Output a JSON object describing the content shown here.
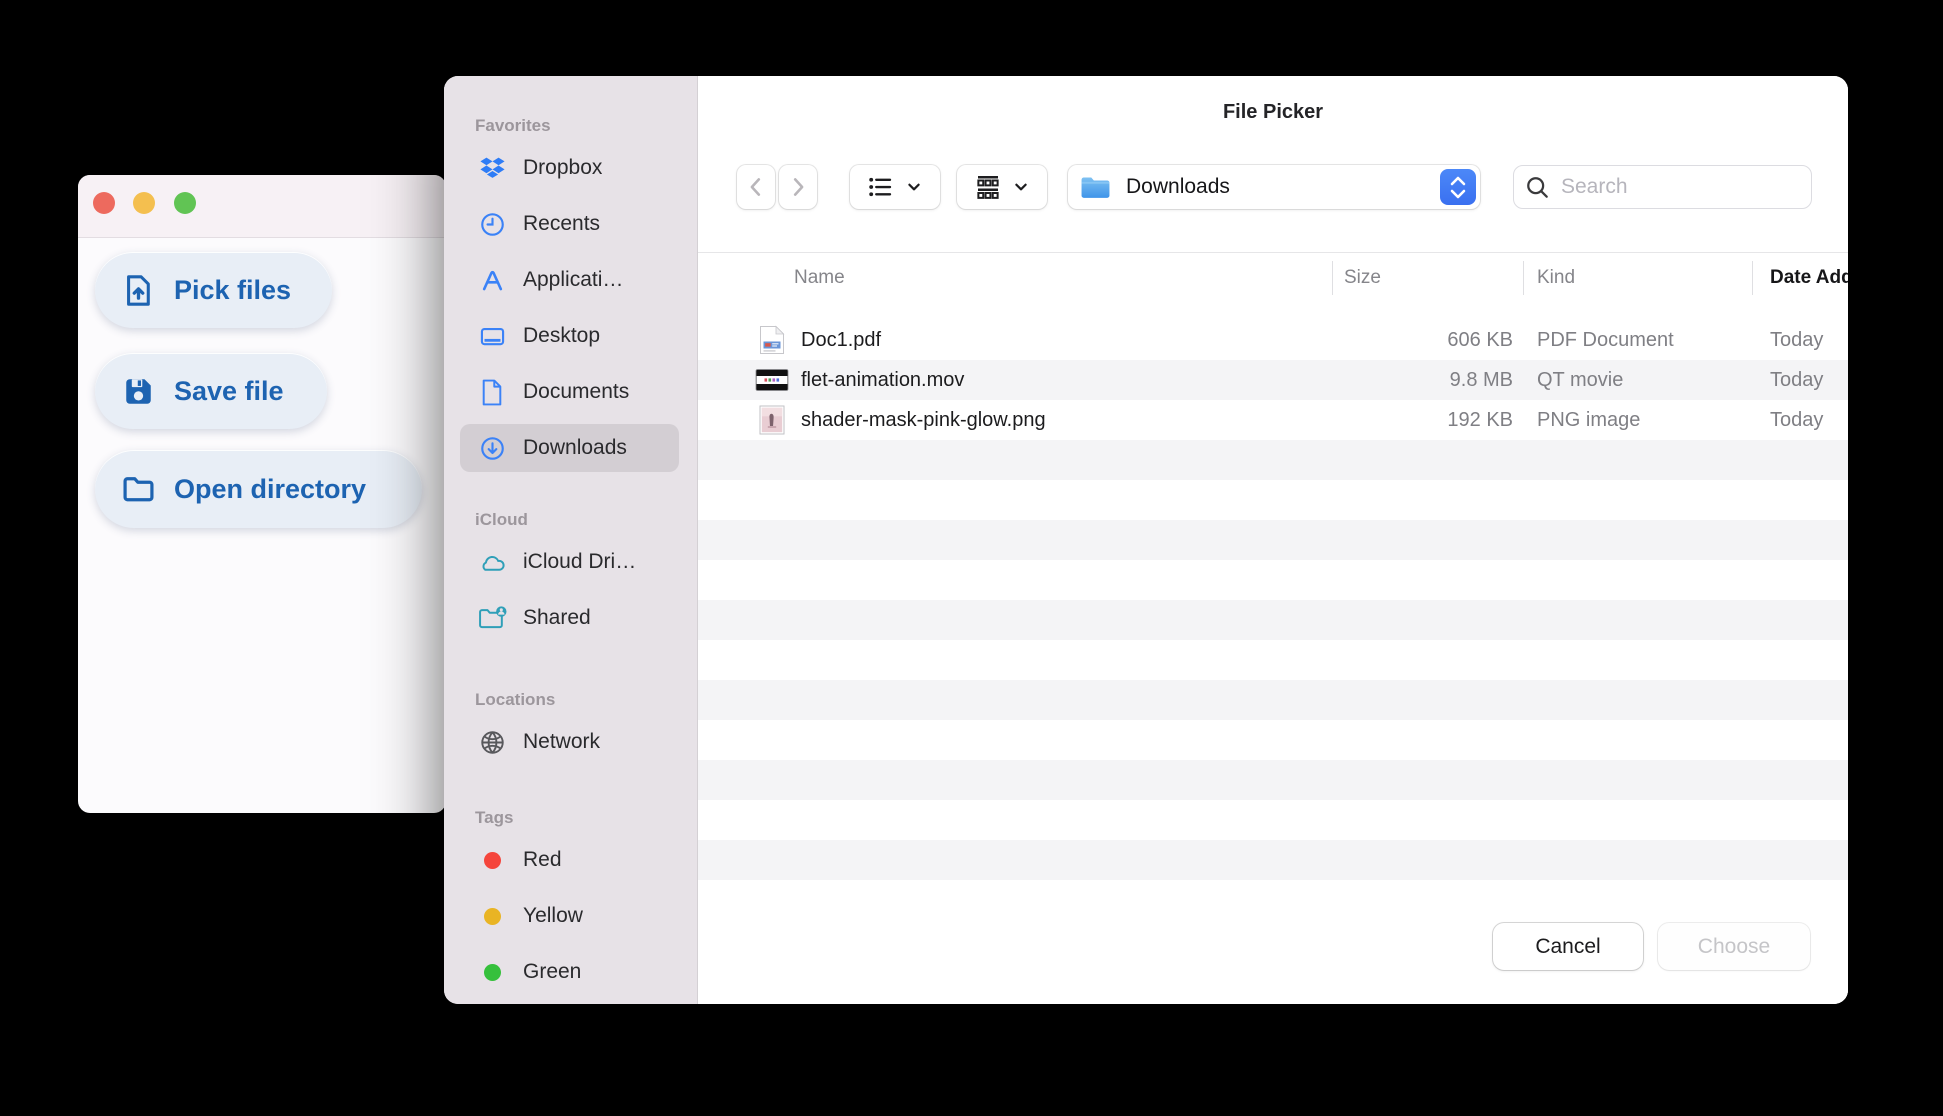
{
  "app_window": {
    "traffic_lights": [
      "close",
      "minimize",
      "zoom"
    ],
    "accent_color": "#1d63b1",
    "buttons": [
      {
        "label": "Pick files",
        "icon": "file-upload"
      },
      {
        "label": "Save file",
        "icon": "save-floppy"
      },
      {
        "label": "Open directory",
        "icon": "folder-open"
      }
    ]
  },
  "dialog": {
    "title": "File Picker",
    "sidebar": {
      "sections": [
        {
          "title": "Favorites",
          "items": [
            {
              "label": "Dropbox",
              "icon": "dropbox",
              "color": "#2e7cf6"
            },
            {
              "label": "Recents",
              "icon": "clock",
              "color": "#3b82f7"
            },
            {
              "label": "Applicati…",
              "icon": "app-store",
              "color": "#3b82f7"
            },
            {
              "label": "Desktop",
              "icon": "desktop",
              "color": "#3b82f7"
            },
            {
              "label": "Documents",
              "icon": "document",
              "color": "#3b82f7"
            },
            {
              "label": "Downloads",
              "icon": "download-circle",
              "color": "#3b82f7",
              "selected": true
            }
          ]
        },
        {
          "title": "iCloud",
          "items": [
            {
              "label": "iCloud Dri…",
              "icon": "cloud",
              "color": "#2f9fb8"
            },
            {
              "label": "Shared",
              "icon": "shared-folder",
              "color": "#2f9fb8"
            }
          ]
        },
        {
          "title": "Locations",
          "items": [
            {
              "label": "Network",
              "icon": "globe",
              "color": "#58585c"
            }
          ]
        },
        {
          "title": "Tags",
          "items": [
            {
              "label": "Red",
              "icon": "tag-dot",
              "color": "#f5453c"
            },
            {
              "label": "Yellow",
              "icon": "tag-dot",
              "color": "#e9b424"
            },
            {
              "label": "Green",
              "icon": "tag-dot",
              "color": "#36c03c"
            }
          ]
        }
      ]
    },
    "toolbar": {
      "back_icon": "chevron-left",
      "forward_icon": "chevron-right",
      "view_buttons": [
        "list-view",
        "group-view"
      ],
      "location": {
        "label": "Downloads",
        "icon": "folder-blue",
        "stepper_color": "#3d7bf7"
      },
      "search": {
        "placeholder": "Search",
        "icon": "magnifier"
      }
    },
    "table": {
      "columns": [
        "Name",
        "Size",
        "Kind",
        "Date Added"
      ],
      "sort_column": "Date Added",
      "rows": [
        {
          "name": "Doc1.pdf",
          "size": "606 KB",
          "kind": "PDF Document",
          "date_added": "Today",
          "icon": "file-pdf"
        },
        {
          "name": "flet-animation.mov",
          "size": "9.8 MB",
          "kind": "QT movie",
          "date_added": "Today",
          "icon": "file-mov"
        },
        {
          "name": "shader-mask-pink-glow.png",
          "size": "192 KB",
          "kind": "PNG image",
          "date_added": "Today",
          "icon": "file-png"
        }
      ],
      "empty_stripe_count": 11
    },
    "footer": {
      "cancel_label": "Cancel",
      "choose_label": "Choose",
      "choose_enabled": false
    }
  }
}
